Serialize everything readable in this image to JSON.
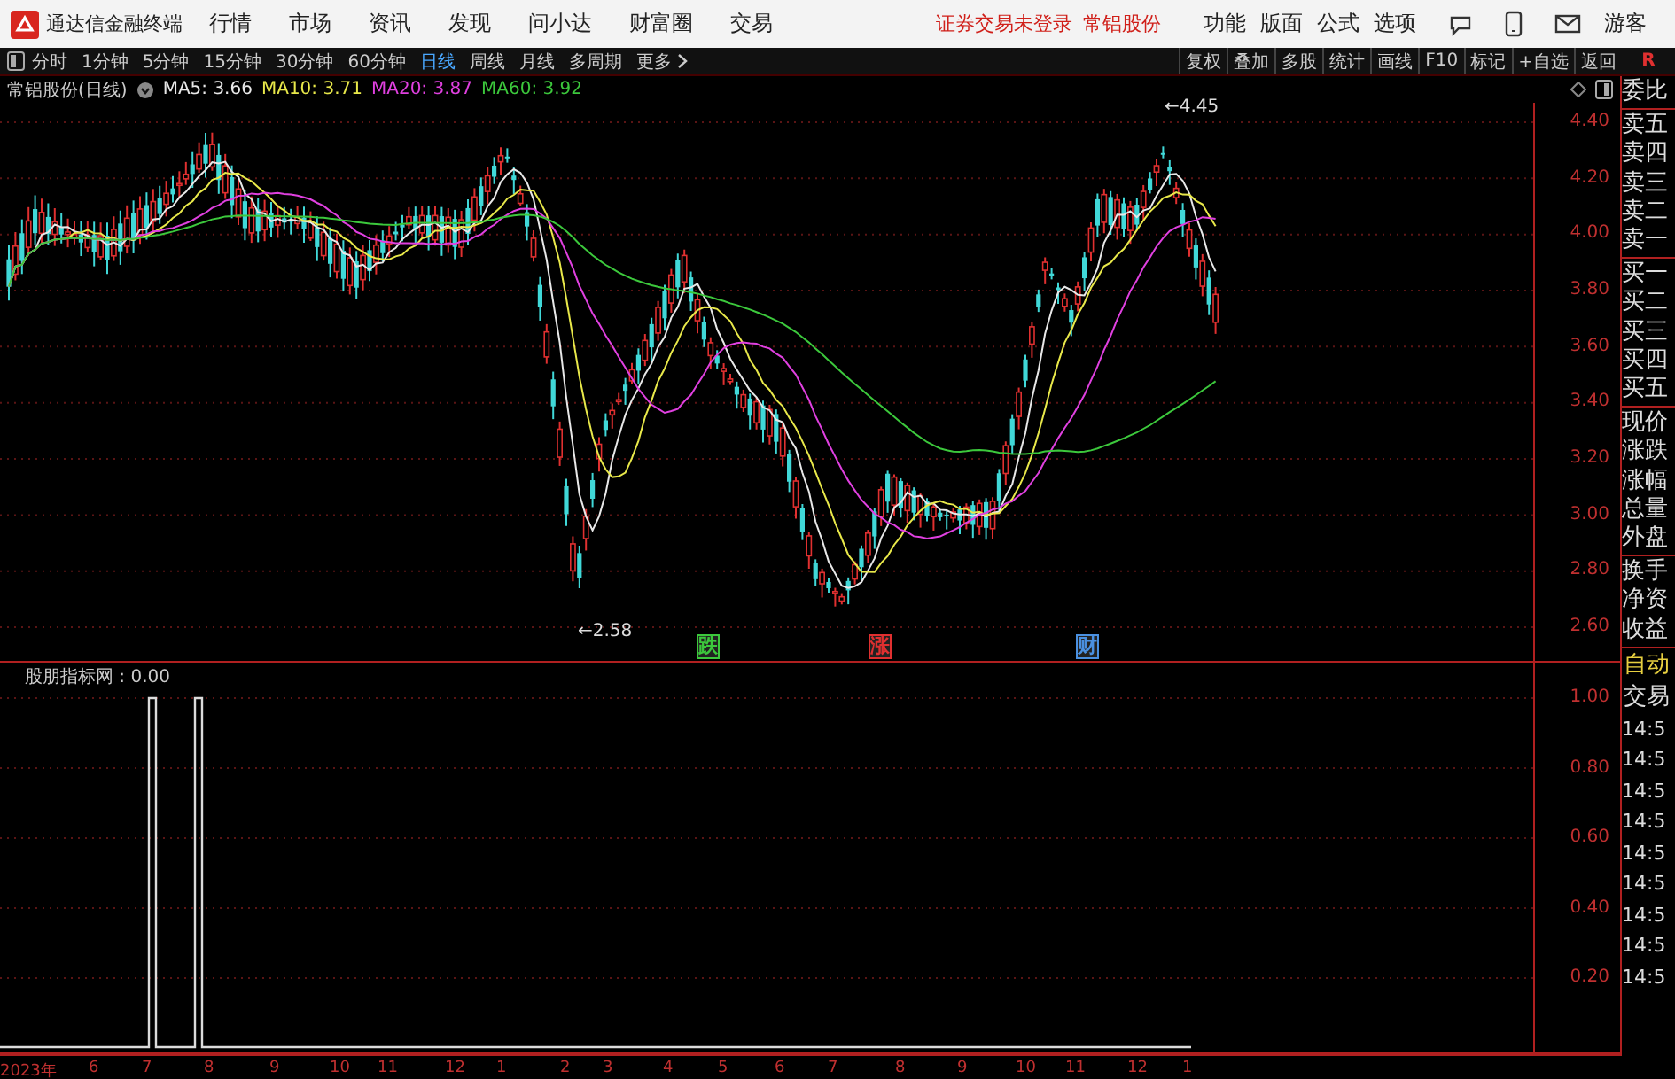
{
  "title_bar": {
    "app_name": "通达信金融终端",
    "menus": [
      "行情",
      "市场",
      "资讯",
      "发现",
      "问小达",
      "财富圈",
      "交易"
    ],
    "notices": [
      "证券交易未登录",
      "常铝股份"
    ],
    "actions": [
      "功能",
      "版面",
      "公式",
      "选项"
    ],
    "user": "游客"
  },
  "toolbar": {
    "periods": [
      {
        "label": "分时",
        "selected": false
      },
      {
        "label": "1分钟",
        "selected": false
      },
      {
        "label": "5分钟",
        "selected": false
      },
      {
        "label": "15分钟",
        "selected": false
      },
      {
        "label": "30分钟",
        "selected": false
      },
      {
        "label": "60分钟",
        "selected": false
      },
      {
        "label": "日线",
        "selected": true
      },
      {
        "label": "周线",
        "selected": false
      },
      {
        "label": "月线",
        "selected": false
      },
      {
        "label": "多周期",
        "selected": false
      }
    ],
    "more": "更多",
    "tools": [
      "复权",
      "叠加",
      "多股",
      "统计",
      "画线",
      "F10",
      "标记",
      "+自选",
      "返回"
    ],
    "right_mark": "R"
  },
  "info_bar": {
    "title": "常铝股份(日线)",
    "indicators": [
      {
        "label": "MA5: 3.66",
        "color": "#e8e8e8"
      },
      {
        "label": "MA10: 3.71",
        "color": "#e8e84a"
      },
      {
        "label": "MA20: 3.87",
        "color": "#e040e0"
      },
      {
        "label": "MA60: 3.92",
        "color": "#3cc83c"
      }
    ]
  },
  "price_chart": {
    "yticks": [
      "4.40",
      "4.20",
      "4.00",
      "3.80",
      "3.60",
      "3.40",
      "3.20",
      "3.00",
      "2.80",
      "2.60"
    ],
    "markers": [
      {
        "kind": "high",
        "text": "←4.45"
      },
      {
        "kind": "low",
        "text": "←2.58"
      }
    ],
    "signals": [
      {
        "text": "跌",
        "color": "#3cc83c"
      },
      {
        "text": "涨",
        "color": "#e03030"
      },
      {
        "text": "财",
        "color": "#4a90e0"
      }
    ]
  },
  "indicator_panel": {
    "title": "股朋指标网 : 0.00",
    "yticks": [
      "1.00",
      "0.80",
      "0.60",
      "0.40",
      "0.20"
    ]
  },
  "x_axis": {
    "labels": [
      "2023年",
      "6",
      "7",
      "8",
      "9",
      "10",
      "11",
      "12",
      "1",
      "2",
      "3",
      "4",
      "5",
      "6",
      "7",
      "8",
      "9",
      "10",
      "11",
      "12",
      "1"
    ]
  },
  "quote_panel": {
    "sections": [
      [
        "委比"
      ],
      [
        "卖五",
        "卖四",
        "卖三",
        "卖二",
        "卖一"
      ],
      [
        "买一",
        "买二",
        "买三",
        "买四",
        "买五"
      ],
      [
        "现价",
        "涨跌",
        "涨幅",
        "总量",
        "外盘"
      ],
      [
        "换手",
        "净资",
        "收益"
      ]
    ],
    "tabs": [
      {
        "label": "自动",
        "selected": true
      },
      {
        "label": "交易",
        "selected": false
      }
    ],
    "times": [
      "14:5",
      "14:5",
      "14:5",
      "14:5",
      "14:5",
      "14:5",
      "14:5",
      "14:5",
      "14:5"
    ]
  }
}
